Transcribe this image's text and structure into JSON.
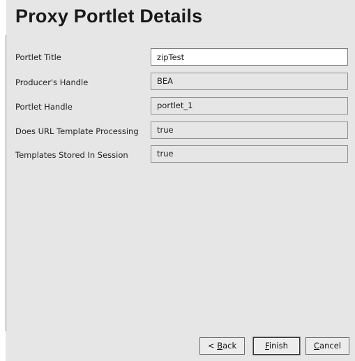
{
  "header": {
    "title": "Proxy Portlet Details"
  },
  "fields": [
    {
      "label": "Portlet Title",
      "value": "zipTest",
      "editable": true
    },
    {
      "label": "Producer's Handle",
      "value": "BEA",
      "editable": false
    },
    {
      "label": "Portlet Handle",
      "value": "portlet_1",
      "editable": false
    },
    {
      "label": "Does URL Template Processing",
      "value": "true",
      "editable": false
    },
    {
      "label": "Templates Stored In Session",
      "value": "true",
      "editable": false
    }
  ],
  "buttons": {
    "back": {
      "prefix": "< ",
      "mnemonic": "B",
      "rest": "ack"
    },
    "finish": {
      "prefix": "",
      "mnemonic": "F",
      "rest": "inish"
    },
    "cancel": {
      "prefix": "",
      "mnemonic": "C",
      "rest": "ancel"
    }
  },
  "colors": {
    "dialog_background": "#e6e6e6",
    "input_background": "#ffffff",
    "border": "#8f8f8f"
  }
}
